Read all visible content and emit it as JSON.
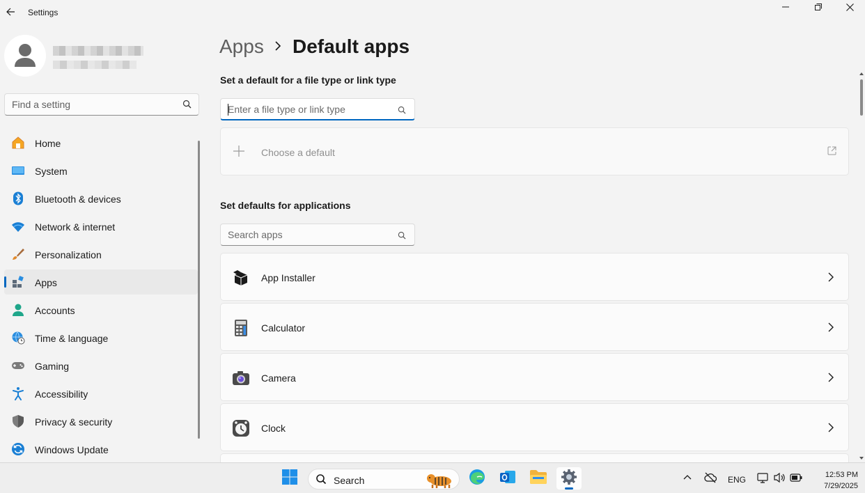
{
  "window": {
    "title": "Settings",
    "back_icon": "back-arrow-icon",
    "controls": [
      "minimize",
      "maximize",
      "close"
    ]
  },
  "sidebar": {
    "search_placeholder": "Find a setting",
    "items": [
      {
        "label": "Home",
        "icon": "home-icon",
        "active": false
      },
      {
        "label": "System",
        "icon": "system-icon",
        "active": false
      },
      {
        "label": "Bluetooth & devices",
        "icon": "bluetooth-icon",
        "active": false
      },
      {
        "label": "Network & internet",
        "icon": "wifi-icon",
        "active": false
      },
      {
        "label": "Personalization",
        "icon": "brush-icon",
        "active": false
      },
      {
        "label": "Apps",
        "icon": "apps-icon",
        "active": true
      },
      {
        "label": "Accounts",
        "icon": "accounts-icon",
        "active": false
      },
      {
        "label": "Time & language",
        "icon": "time-language-icon",
        "active": false
      },
      {
        "label": "Gaming",
        "icon": "gamepad-icon",
        "active": false
      },
      {
        "label": "Accessibility",
        "icon": "accessibility-icon",
        "active": false
      },
      {
        "label": "Privacy & security",
        "icon": "shield-icon",
        "active": false
      },
      {
        "label": "Windows Update",
        "icon": "update-icon",
        "active": false
      }
    ]
  },
  "breadcrumb": {
    "parent": "Apps",
    "current": "Default apps"
  },
  "file_type_section": {
    "title": "Set a default for a file type or link type",
    "input_placeholder": "Enter a file type or link type",
    "choose_label": "Choose a default"
  },
  "apps_section": {
    "title": "Set defaults for applications",
    "search_placeholder": "Search apps",
    "apps": [
      {
        "name": "App Installer",
        "icon": "app-installer-icon"
      },
      {
        "name": "Calculator",
        "icon": "calculator-icon"
      },
      {
        "name": "Camera",
        "icon": "camera-icon"
      },
      {
        "name": "Clock",
        "icon": "clock-icon"
      }
    ]
  },
  "taskbar": {
    "search_label": "Search",
    "pinned": [
      "start-icon",
      "edge-icon",
      "outlook-icon",
      "file-explorer-icon",
      "settings-icon"
    ],
    "language": "ENG",
    "time": "12:53 PM",
    "date": "7/29/2025"
  },
  "colors": {
    "accent": "#0067c0",
    "background": "#f3f3f3",
    "card": "#fbfbfb"
  }
}
